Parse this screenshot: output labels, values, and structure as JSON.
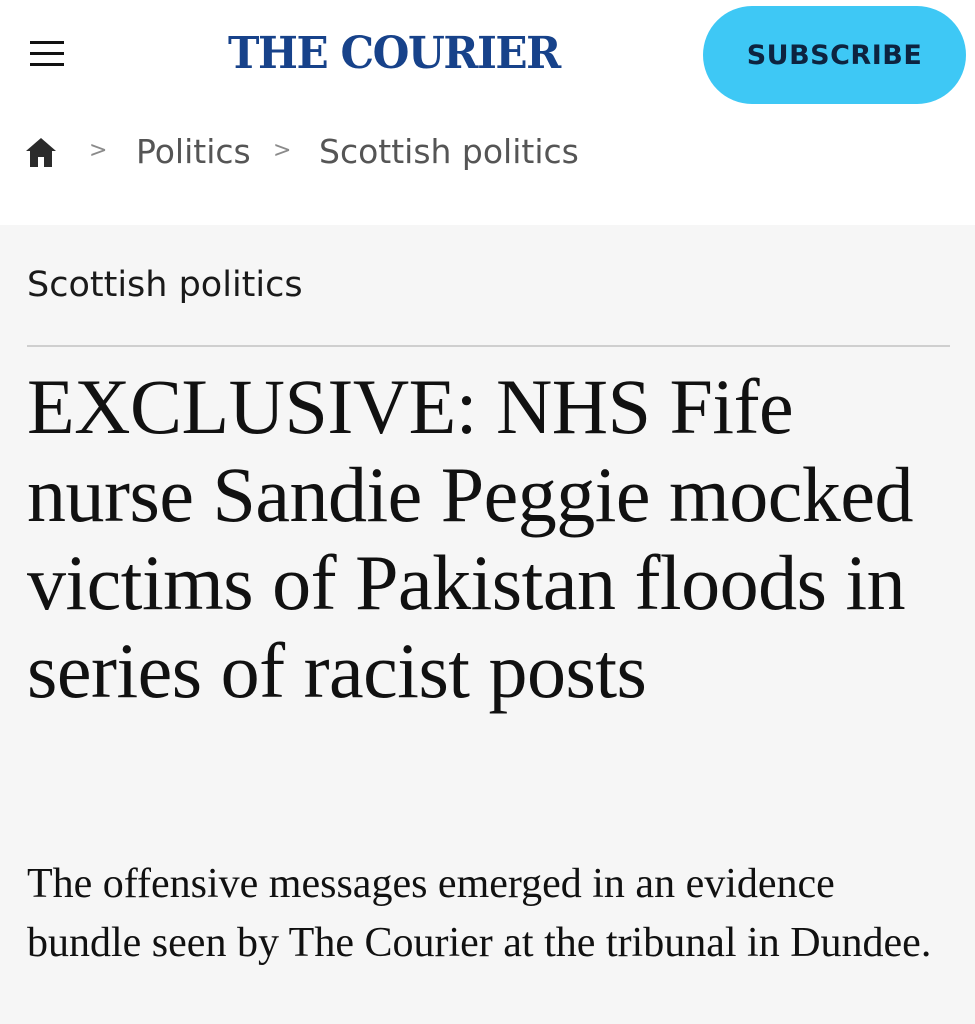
{
  "header": {
    "menu_icon": "hamburger-menu-icon",
    "logo_text": "THE COURIER",
    "subscribe_label": "SUBSCRIBE",
    "colors": {
      "logo": "#17428a",
      "subscribe_bg": "#3ec8f5",
      "subscribe_text": "#0d2440"
    }
  },
  "breadcrumb": {
    "home_icon": "home-icon",
    "separator": ">",
    "items": [
      {
        "label": "Politics"
      },
      {
        "label": "Scottish politics"
      }
    ]
  },
  "article": {
    "section": "Scottish politics",
    "headline": "EXCLUSIVE: NHS Fife nurse Sandie Peggie mocked victims of Pakistan floods in series of racist posts",
    "standfirst": "The offensive messages emerged in an evidence bundle seen by The Courier at the tribunal in Dundee.",
    "background": "#f6f6f6"
  }
}
